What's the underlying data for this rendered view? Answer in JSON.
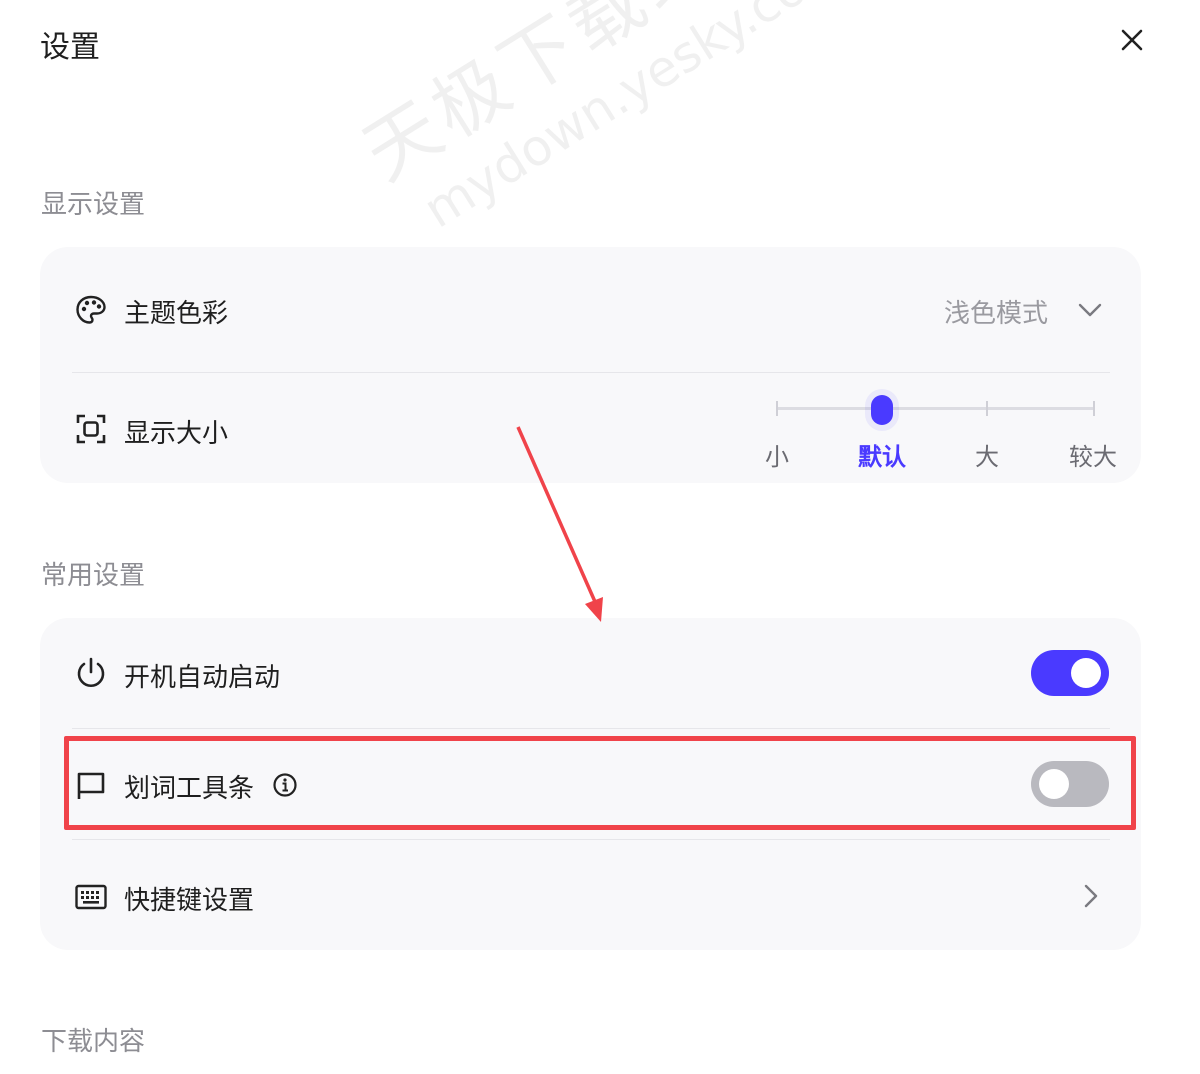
{
  "dialog": {
    "title": "设置"
  },
  "display": {
    "section_title": "显示设置",
    "theme": {
      "label": "主题色彩",
      "value": "浅色模式"
    },
    "size": {
      "label": "显示大小",
      "options": [
        "小",
        "默认",
        "大",
        "较大"
      ],
      "selected_index": 1
    }
  },
  "common": {
    "section_title": "常用设置",
    "autostart": {
      "label": "开机自动启动",
      "enabled": true
    },
    "toolbar": {
      "label": "划词工具条",
      "enabled": false
    },
    "shortcut": {
      "label": "快捷键设置"
    }
  },
  "download": {
    "section_title": "下载内容"
  },
  "watermark": {
    "line1": "天极下载站",
    "line2": "mydown.yesky.com"
  },
  "colors": {
    "accent": "#4a3aff",
    "toggle_off": "#b9b9bf",
    "highlight": "#f0434a"
  },
  "icons": [
    "close-icon",
    "palette-icon",
    "screen-size-icon",
    "power-icon",
    "flag-icon",
    "info-icon",
    "keyboard-icon",
    "chevron-down-icon",
    "chevron-right-icon"
  ]
}
